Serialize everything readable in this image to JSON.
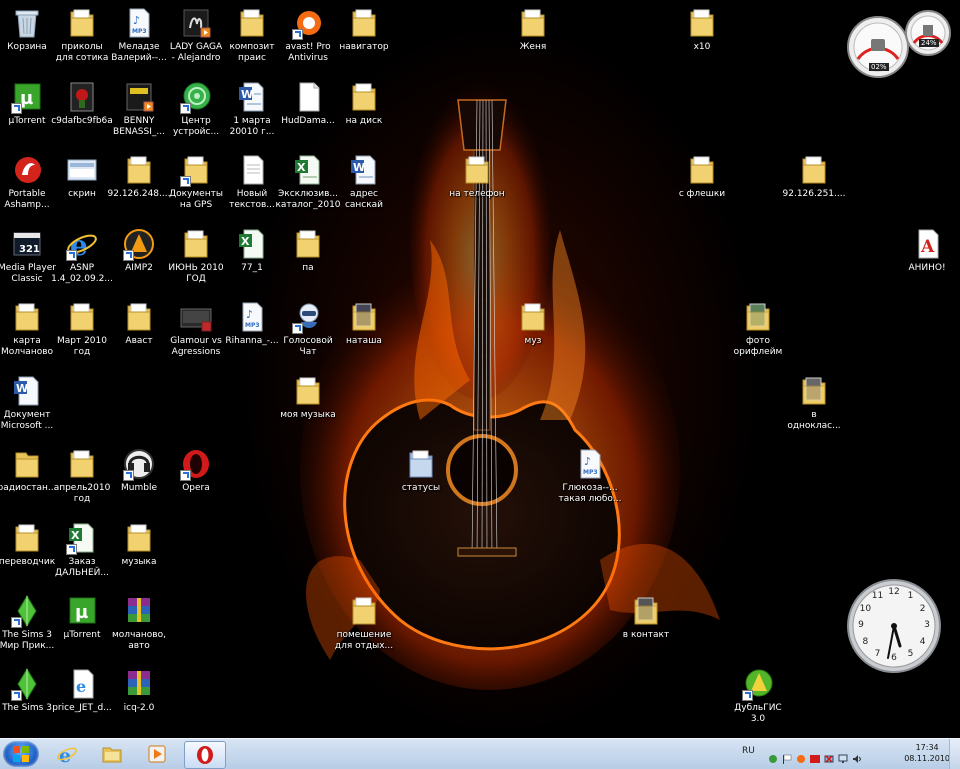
{
  "desktop_icons": [
    {
      "label": "Корзина",
      "icon": "recycle-bin-icon"
    },
    {
      "label": "приколы\nдля сотика",
      "icon": "folder-icon"
    },
    {
      "label": "Меладзе\nВалерий--...",
      "icon": "mp3-icon"
    },
    {
      "label": "LADY GAGA\n- Alejandro",
      "icon": "video-icon"
    },
    {
      "label": "композит\nпраис",
      "icon": "folder-icon"
    },
    {
      "label": "avast! Pro\nAntivirus",
      "icon": "avast-icon"
    },
    {
      "label": "навигатор",
      "icon": "folder-icon"
    },
    {
      "label": "Женя",
      "icon": "folder-icon"
    },
    {
      "label": "x10",
      "icon": "folder-icon"
    },
    {
      "label": "µTorrent",
      "icon": "utorrent-icon"
    },
    {
      "label": "c9dafbc9fb6a",
      "icon": "image-icon"
    },
    {
      "label": "BENNY\nBENASSI_...",
      "icon": "video-icon"
    },
    {
      "label": "Центр\nустройс...",
      "icon": "device-center-icon"
    },
    {
      "label": "1 марта\n20010 г...",
      "icon": "word-doc-icon"
    },
    {
      "label": "HudDama...",
      "icon": "blank-file-icon"
    },
    {
      "label": "на диск",
      "icon": "folder-icon"
    },
    {
      "label": "Portable\nAshamp...",
      "icon": "ashampoo-icon"
    },
    {
      "label": "скрин",
      "icon": "screenshot-icon"
    },
    {
      "label": "92.126.248....",
      "icon": "folder-icon"
    },
    {
      "label": "Документы\nна GPS",
      "icon": "folder-icon"
    },
    {
      "label": "Новый\nтекстов...",
      "icon": "text-file-icon"
    },
    {
      "label": "Эксклюзив...\nкаталог_2010",
      "icon": "excel-icon"
    },
    {
      "label": "адрес\nсанскай",
      "icon": "word-doc-icon"
    },
    {
      "label": "на телефон",
      "icon": "folder-icon"
    },
    {
      "label": "с флешки",
      "icon": "folder-icon"
    },
    {
      "label": "92.126.251....",
      "icon": "folder-icon"
    },
    {
      "label": "Media Player\nClassic",
      "icon": "media-player-icon"
    },
    {
      "label": "ASNP\n1.4_02.09.2...",
      "icon": "ie-icon"
    },
    {
      "label": "AIMP2",
      "icon": "aimp-icon"
    },
    {
      "label": "ИЮНЬ 2010\nГОД",
      "icon": "folder-icon"
    },
    {
      "label": "77_1",
      "icon": "excel-icon"
    },
    {
      "label": "па",
      "icon": "folder-icon"
    },
    {
      "label": "АНИНО!",
      "icon": "pdf-icon"
    },
    {
      "label": "карта\nМолчаново",
      "icon": "folder-icon"
    },
    {
      "label": "Март 2010\nгод",
      "icon": "folder-icon"
    },
    {
      "label": "Аваст",
      "icon": "folder-icon"
    },
    {
      "label": "Glamour vs\nAgressions",
      "icon": "video-icon"
    },
    {
      "label": "Rihanna_-...",
      "icon": "mp3-icon"
    },
    {
      "label": "Голосовой\nЧат",
      "icon": "voice-chat-icon"
    },
    {
      "label": "наташа",
      "icon": "folder-icon"
    },
    {
      "label": "муз",
      "icon": "folder-icon"
    },
    {
      "label": "фото\nорифлейм",
      "icon": "folder-icon"
    },
    {
      "label": "моя музыка",
      "icon": "folder-icon"
    },
    {
      "label": "Документ\nMicrosoft ...",
      "icon": "word-doc-icon"
    },
    {
      "label": "в\nоднoклас...",
      "icon": "folder-icon"
    },
    {
      "label": "радиостан...",
      "icon": "folder-icon"
    },
    {
      "label": "апрель2010\nгод",
      "icon": "folder-icon"
    },
    {
      "label": "Mumble",
      "icon": "mumble-icon"
    },
    {
      "label": "Opera",
      "icon": "opera-icon"
    },
    {
      "label": "статусы",
      "icon": "folder-icon"
    },
    {
      "label": "Глюкоза--...\nтакая любо...",
      "icon": "mp3-icon"
    },
    {
      "label": "переводчик",
      "icon": "folder-icon"
    },
    {
      "label": "Заказ\nДАЛЬНЕЙ...",
      "icon": "excel-icon"
    },
    {
      "label": "музыка",
      "icon": "folder-icon"
    },
    {
      "label": "The Sims 3\nМир Прик...",
      "icon": "sims-icon"
    },
    {
      "label": "µTorrent",
      "icon": "utorrent-icon"
    },
    {
      "label": "молчаново,\nавто",
      "icon": "winrar-icon"
    },
    {
      "label": "помешение\nдля отдых...",
      "icon": "folder-icon"
    },
    {
      "label": "в контакт",
      "icon": "folder-icon"
    },
    {
      "label": "The Sims 3",
      "icon": "sims-icon"
    },
    {
      "label": "price_JET_d...",
      "icon": "ie-doc-icon"
    },
    {
      "label": "icq-2.0",
      "icon": "winrar-icon"
    },
    {
      "label": "ДубльГИС\n3.0",
      "icon": "dublgis-icon"
    }
  ],
  "gadgets": {
    "cpu_meter": {
      "cpu": "02%",
      "ram": "24%"
    },
    "clock_gadget": {
      "numerals": [
        "12",
        "1",
        "2",
        "3",
        "4",
        "5",
        "6",
        "7",
        "8",
        "9",
        "10",
        "11"
      ]
    }
  },
  "taskbar": {
    "pinned": [
      "ie-icon",
      "explorer-icon",
      "media-player-icon",
      "opera-icon"
    ],
    "language": "RU",
    "time": "17:34",
    "date": "08.11.2010"
  }
}
